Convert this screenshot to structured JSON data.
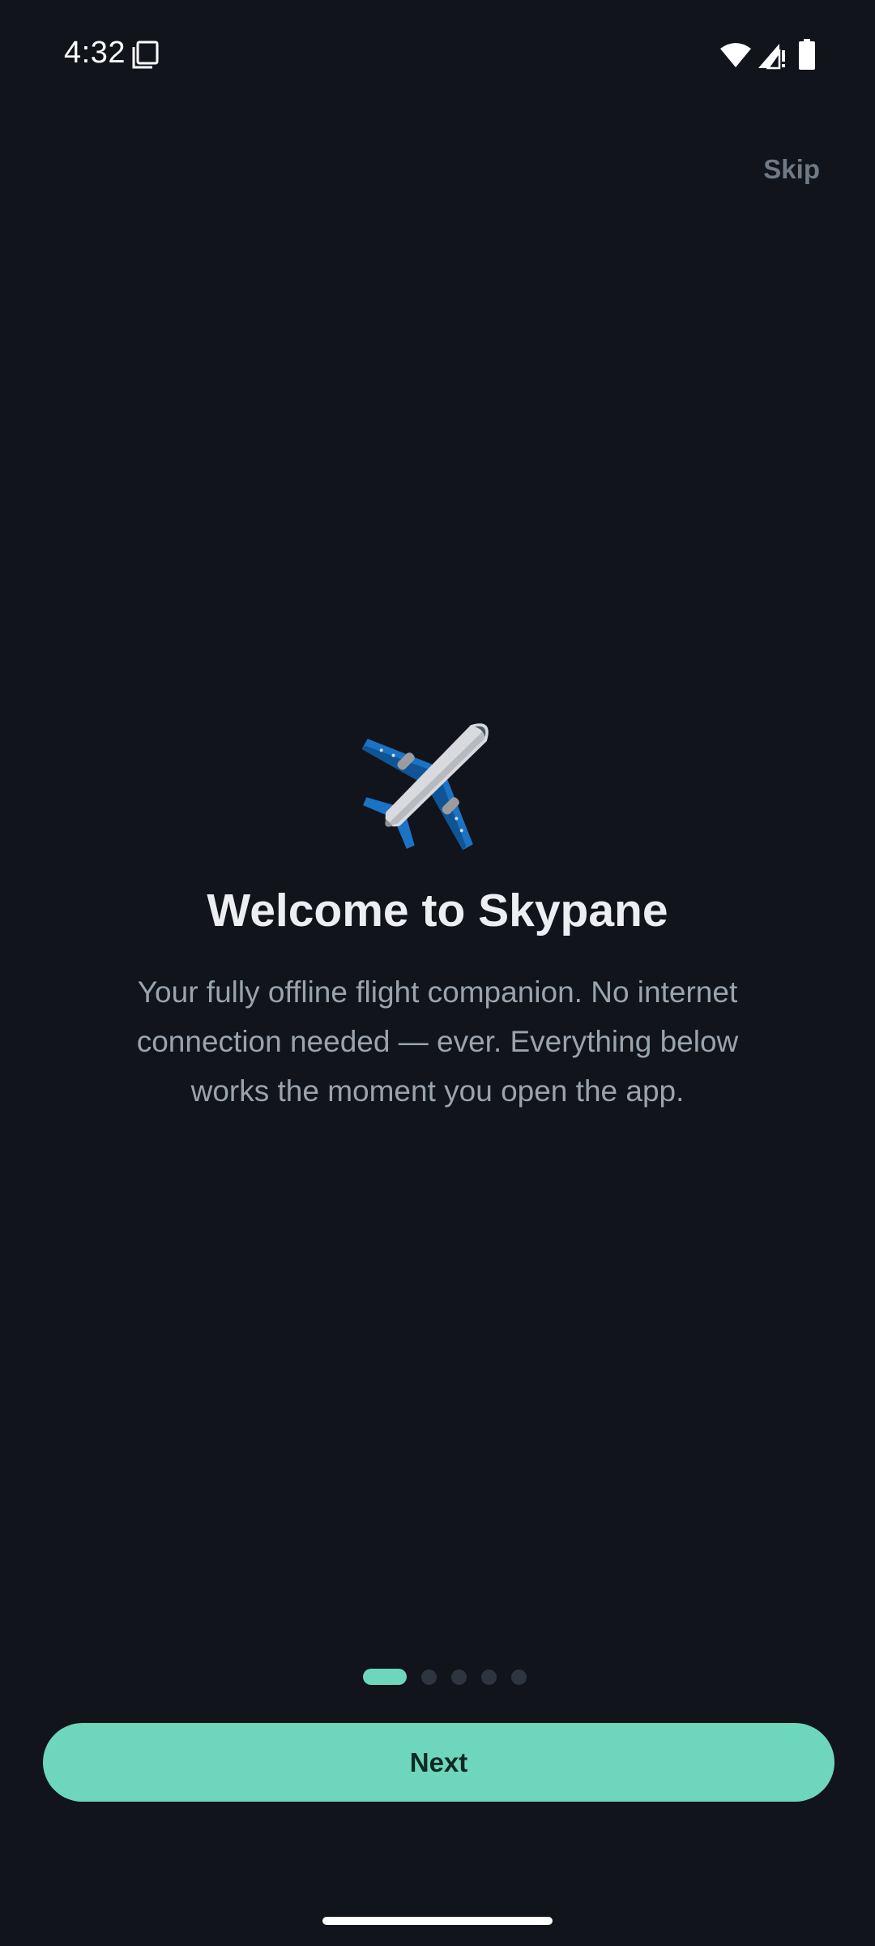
{
  "status_bar": {
    "time": "4:32",
    "icons": [
      "screenshot-icon",
      "wifi-icon",
      "signal-icon",
      "battery-icon"
    ]
  },
  "header": {
    "skip_label": "Skip"
  },
  "onboarding": {
    "illustration": "airplane-icon",
    "title": "Welcome to Skypane",
    "description": "Your fully offline flight companion. No internet connection needed — ever. Everything below works the moment you open the app."
  },
  "pager": {
    "total_pages": 5,
    "current_page": 1
  },
  "footer": {
    "next_label": "Next"
  },
  "colors": {
    "background": "#11141b",
    "accent": "#6ed6bd",
    "title_text": "#eceef2",
    "body_text": "#9aa3ae",
    "skip_text": "#707a86",
    "plane_blue": "#1a73c4",
    "plane_body": "#d8dadd"
  }
}
